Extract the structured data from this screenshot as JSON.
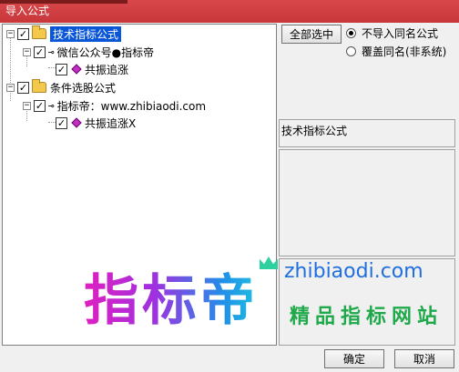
{
  "window": {
    "title": "导入公式"
  },
  "tree": {
    "nodes": [
      {
        "label": "技术指标公式",
        "checked": "✓",
        "expander": "−"
      },
      {
        "label": "微信公众号●指标帝",
        "checked": "✓",
        "expander": "−"
      },
      {
        "label": "共振追涨",
        "checked": "✓"
      },
      {
        "label": "条件选股公式",
        "checked": "✓",
        "expander": "−"
      },
      {
        "label": "指标帝：www.zhibiaodi.com",
        "checked": "✓",
        "expander": "−"
      },
      {
        "label": "共振追涨X",
        "checked": "✓"
      }
    ]
  },
  "right": {
    "select_all_button": "全部选中",
    "radio_no_import": "不导入同名公式",
    "radio_overwrite": "覆盖同名(非系统)",
    "info_text": "技术指标公式"
  },
  "watermark": {
    "brand": "指标帝",
    "url": "zhibiaodi.com",
    "slogan": "精品指标网站"
  },
  "footer": {
    "ok_button": "确定",
    "cancel_button": "取消"
  },
  "colors": {
    "titlebar": "#c8373a",
    "selection": "#0a56d8",
    "brand_gradient_start": "#e020c0",
    "brand_gradient_end": "#20c0e0",
    "url": "#1f6fe0",
    "slogan": "#1fa94a"
  }
}
